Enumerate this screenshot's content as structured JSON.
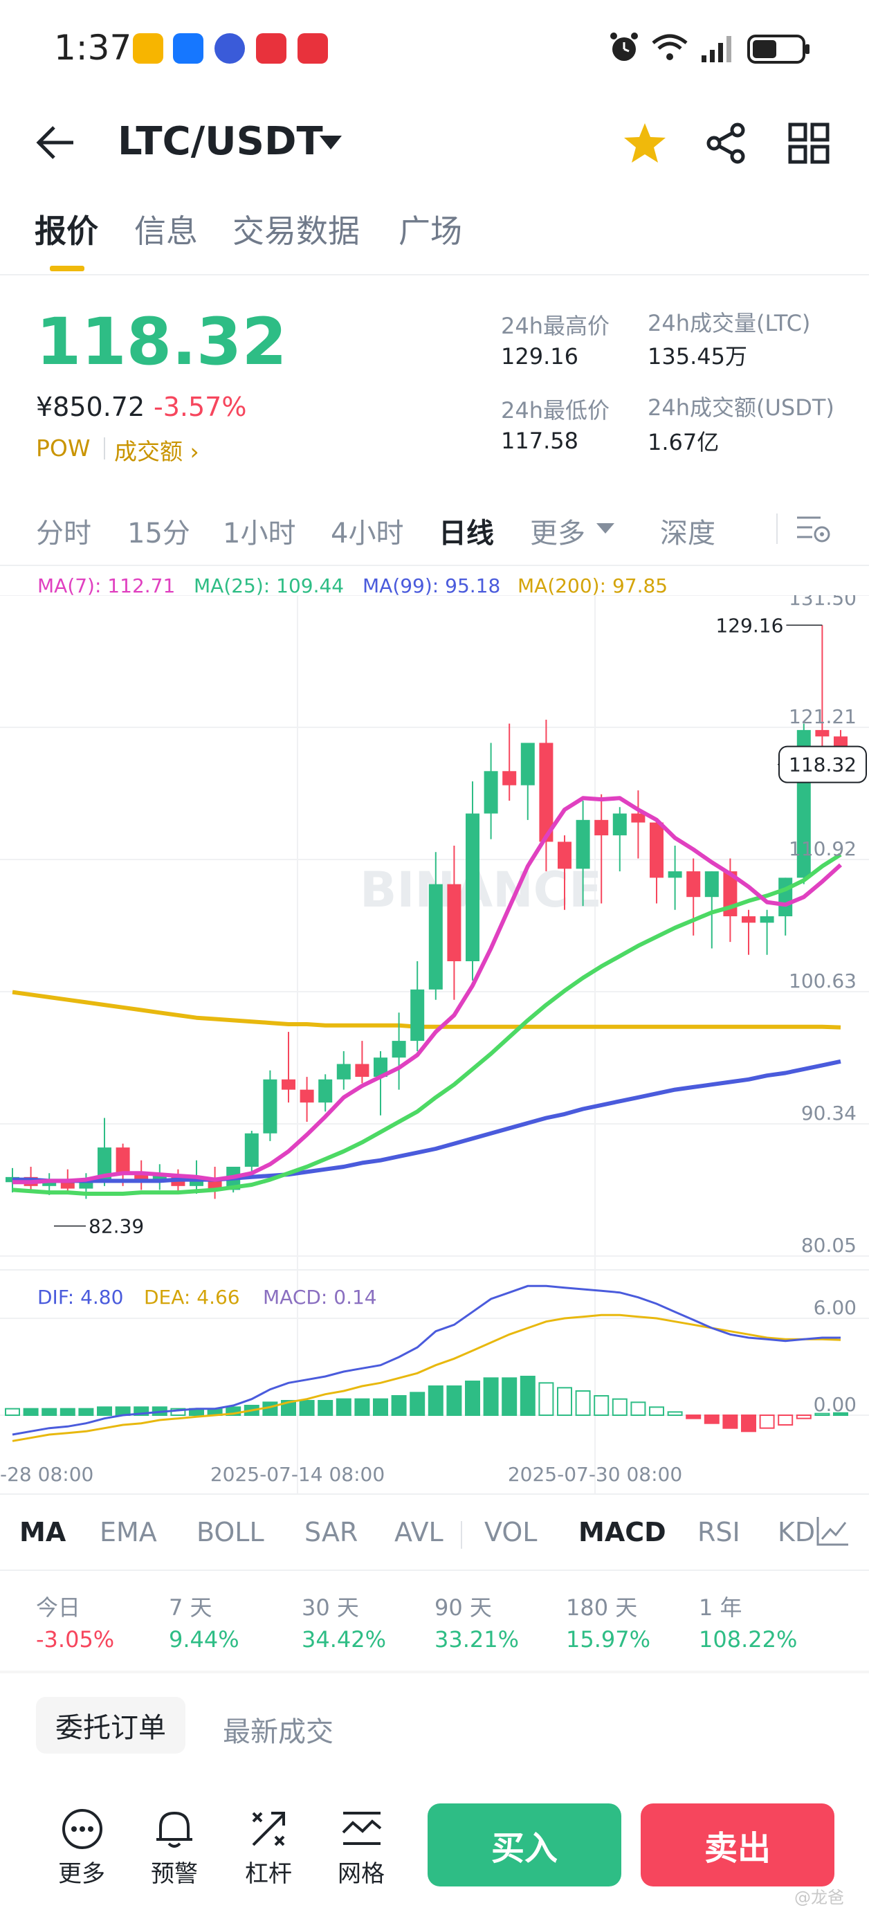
{
  "status_bar": {
    "time": "1:37"
  },
  "header": {
    "pair": "LTC/USDT"
  },
  "tabs": [
    "报价",
    "信息",
    "交易数据",
    "广场"
  ],
  "price": {
    "last": "118.32",
    "cny": "¥850.72",
    "change": "-3.57%",
    "pow": "POW",
    "volume_link": "成交额",
    "high_label": "24h最高价",
    "high": "129.16",
    "low_label": "24h最低价",
    "low": "117.58",
    "vol_ltc_label": "24h成交量(LTC)",
    "vol_ltc": "135.45万",
    "vol_usdt_label": "24h成交额(USDT)",
    "vol_usdt": "1.67亿"
  },
  "intervals": [
    "分时",
    "15分",
    "1小时",
    "4小时",
    "日线",
    "更多",
    "深度"
  ],
  "ma_legend": [
    "MA(7): 112.71",
    "MA(25): 109.44",
    "MA(99): 95.18",
    "MA(200): 97.85"
  ],
  "macd_legend": [
    "DIF: 4.80",
    "DEA: 4.66",
    "MACD: 0.14"
  ],
  "colors": {
    "up": "#2ebd85",
    "down": "#f6465d",
    "ma7": "#e040c0",
    "ma25": "#4cd964",
    "ma99": "#4a5bdc",
    "ma200": "#e8b80e",
    "dif": "#4a5bdc",
    "dea": "#e8b80e"
  },
  "chart_data": {
    "type": "candlestick",
    "price_axis_ticks": [
      "131.50",
      "121.21",
      "110.92",
      "100.63",
      "90.34",
      "80.05"
    ],
    "macd_axis_ticks": [
      "6.00",
      "0.00"
    ],
    "date_ticks": [
      "-28 08:00",
      "2025-07-14 08:00",
      "2025-07-30 08:00"
    ],
    "current_price_tag": "118.32",
    "high_annotation": "129.16",
    "low_annotation": "82.39",
    "watermark": "BINANCE",
    "candles": [
      [
        85.8,
        86.9,
        85.0,
        86.2
      ],
      [
        86.2,
        87.0,
        85.2,
        85.5
      ],
      [
        85.5,
        86.5,
        84.8,
        86.0
      ],
      [
        86.0,
        86.8,
        85.0,
        85.3
      ],
      [
        85.3,
        86.5,
        84.5,
        86.0
      ],
      [
        86.0,
        90.8,
        85.5,
        88.5
      ],
      [
        88.5,
        88.8,
        85.5,
        86.5
      ],
      [
        86.5,
        87.5,
        85.2,
        85.8
      ],
      [
        85.8,
        87.2,
        85.2,
        86.3
      ],
      [
        86.3,
        86.8,
        85.0,
        85.5
      ],
      [
        85.5,
        87.5,
        84.9,
        86.0
      ],
      [
        86.0,
        87.0,
        84.5,
        85.2
      ],
      [
        85.2,
        87.0,
        85.0,
        87.0
      ],
      [
        87.0,
        89.8,
        86.5,
        89.6
      ],
      [
        89.6,
        94.5,
        89.0,
        93.8
      ],
      [
        93.8,
        97.5,
        92.0,
        93.0
      ],
      [
        93.0,
        94.0,
        90.5,
        92.0
      ],
      [
        92.0,
        94.2,
        91.3,
        93.8
      ],
      [
        93.8,
        96.0,
        93.0,
        95.0
      ],
      [
        95.0,
        96.8,
        93.5,
        94.0
      ],
      [
        94.0,
        96.0,
        91.0,
        95.5
      ],
      [
        95.5,
        99.0,
        93.0,
        96.8
      ],
      [
        96.8,
        103.0,
        96.0,
        100.8
      ],
      [
        100.8,
        111.5,
        100.0,
        109.0
      ],
      [
        109.0,
        112.0,
        100.0,
        103.0
      ],
      [
        103.0,
        117.0,
        101.5,
        114.5
      ],
      [
        114.5,
        120.0,
        112.5,
        117.8
      ],
      [
        117.8,
        121.5,
        115.5,
        116.7
      ],
      [
        116.7,
        120.0,
        114.0,
        120.0
      ],
      [
        120.0,
        121.8,
        110.0,
        112.3
      ],
      [
        112.3,
        112.8,
        107.0,
        110.2
      ],
      [
        110.2,
        115.5,
        107.3,
        114.0
      ],
      [
        114.0,
        116.0,
        107.5,
        112.8
      ],
      [
        112.8,
        115.0,
        110.0,
        114.5
      ],
      [
        114.5,
        116.3,
        111.0,
        113.8
      ],
      [
        113.8,
        114.0,
        107.5,
        109.5
      ],
      [
        109.5,
        112.0,
        107.0,
        110.0
      ],
      [
        110.0,
        111.0,
        105.0,
        108.0
      ],
      [
        108.0,
        110.0,
        104.0,
        110.0
      ],
      [
        110.0,
        111.0,
        104.5,
        106.5
      ],
      [
        106.5,
        107.0,
        103.5,
        106.0
      ],
      [
        106.0,
        107.0,
        103.5,
        106.5
      ],
      [
        106.5,
        109.5,
        105.0,
        109.5
      ],
      [
        109.5,
        121.5,
        109.0,
        121.0
      ],
      [
        121.0,
        129.16,
        119.5,
        120.5
      ],
      [
        120.5,
        121.0,
        117.58,
        118.32
      ]
    ],
    "ma7": [
      85.8,
      85.8,
      85.9,
      85.9,
      86.0,
      86.3,
      86.5,
      86.5,
      86.4,
      86.3,
      86.2,
      86.0,
      86.2,
      86.5,
      87.2,
      88.2,
      89.5,
      90.9,
      92.4,
      93.3,
      94.0,
      94.7,
      95.7,
      97.5,
      98.8,
      101.1,
      104.0,
      107.2,
      110.4,
      112.7,
      114.8,
      115.7,
      115.6,
      115.7,
      114.8,
      114.0,
      112.6,
      111.7,
      110.7,
      109.8,
      108.8,
      107.6,
      107.4,
      108.0,
      109.2,
      110.5
    ],
    "ma25": [
      85.2,
      85.1,
      85.0,
      85.0,
      84.9,
      84.9,
      84.9,
      85.0,
      85.0,
      85.0,
      85.1,
      85.2,
      85.4,
      85.6,
      86.0,
      86.5,
      87.0,
      87.6,
      88.2,
      88.9,
      89.7,
      90.5,
      91.3,
      92.4,
      93.4,
      94.6,
      95.8,
      97.1,
      98.4,
      99.6,
      100.7,
      101.7,
      102.6,
      103.4,
      104.2,
      104.9,
      105.6,
      106.2,
      106.8,
      107.2,
      107.7,
      108.1,
      108.6,
      109.3,
      110.4,
      111.3
    ],
    "ma99": [
      86.0,
      86.0,
      85.9,
      85.9,
      85.9,
      85.9,
      85.9,
      85.9,
      85.9,
      86.0,
      86.0,
      86.0,
      86.1,
      86.2,
      86.3,
      86.4,
      86.6,
      86.8,
      87.0,
      87.3,
      87.5,
      87.8,
      88.1,
      88.4,
      88.8,
      89.2,
      89.6,
      90.0,
      90.4,
      90.8,
      91.1,
      91.5,
      91.8,
      92.1,
      92.4,
      92.7,
      93.0,
      93.2,
      93.4,
      93.6,
      93.8,
      94.1,
      94.3,
      94.6,
      94.9,
      95.2
    ],
    "ma200": [
      100.6,
      100.4,
      100.2,
      100.0,
      99.8,
      99.6,
      99.4,
      99.2,
      99.0,
      98.8,
      98.6,
      98.5,
      98.4,
      98.3,
      98.2,
      98.1,
      98.1,
      98.0,
      98.0,
      98.0,
      98.0,
      98.0,
      97.9,
      97.9,
      97.9,
      97.9,
      97.9,
      97.9,
      97.9,
      97.9,
      97.9,
      97.9,
      97.9,
      97.9,
      97.9,
      97.9,
      97.9,
      97.9,
      97.9,
      97.9,
      97.9,
      97.9,
      97.9,
      97.9,
      97.9,
      97.85
    ],
    "macd_hist": [
      0.4,
      0.4,
      0.4,
      0.4,
      0.4,
      0.5,
      0.5,
      0.5,
      0.5,
      0.4,
      0.4,
      0.4,
      0.5,
      0.6,
      0.8,
      0.9,
      0.9,
      0.9,
      1.0,
      1.0,
      1.0,
      1.2,
      1.4,
      1.8,
      1.8,
      2.1,
      2.3,
      2.3,
      2.4,
      2.0,
      1.7,
      1.5,
      1.2,
      1.0,
      0.8,
      0.5,
      0.2,
      -0.2,
      -0.5,
      -0.8,
      -1.0,
      -0.8,
      -0.6,
      -0.2,
      0.1,
      0.14
    ],
    "dif": [
      -1.2,
      -1.0,
      -0.8,
      -0.7,
      -0.5,
      -0.2,
      0.0,
      0.1,
      0.2,
      0.3,
      0.4,
      0.4,
      0.6,
      1.0,
      1.6,
      2.0,
      2.2,
      2.4,
      2.7,
      2.9,
      3.1,
      3.6,
      4.2,
      5.2,
      5.6,
      6.4,
      7.2,
      7.6,
      8.0,
      8.0,
      7.9,
      7.8,
      7.7,
      7.6,
      7.3,
      6.9,
      6.4,
      5.9,
      5.4,
      5.0,
      4.8,
      4.7,
      4.6,
      4.7,
      4.8,
      4.8
    ],
    "dea": [
      -1.6,
      -1.4,
      -1.2,
      -1.1,
      -1.0,
      -0.8,
      -0.6,
      -0.5,
      -0.3,
      -0.2,
      -0.1,
      0.0,
      0.1,
      0.3,
      0.5,
      0.8,
      1.0,
      1.3,
      1.5,
      1.8,
      2.0,
      2.3,
      2.6,
      3.1,
      3.5,
      4.0,
      4.5,
      5.0,
      5.4,
      5.8,
      6.0,
      6.1,
      6.2,
      6.2,
      6.1,
      6.0,
      5.8,
      5.6,
      5.4,
      5.2,
      5.0,
      4.8,
      4.7,
      4.7,
      4.7,
      4.66
    ]
  },
  "indicators": [
    "MA",
    "EMA",
    "BOLL",
    "SAR",
    "AVL",
    "VOL",
    "MACD",
    "RSI",
    "KD"
  ],
  "periods": [
    {
      "label": "今日",
      "value": "-3.05%",
      "neg": true
    },
    {
      "label": "7 天",
      "value": "9.44%",
      "neg": false
    },
    {
      "label": "30 天",
      "value": "34.42%",
      "neg": false
    },
    {
      "label": "90 天",
      "value": "33.21%",
      "neg": false
    },
    {
      "label": "180 天",
      "value": "15.97%",
      "neg": false
    },
    {
      "label": "1 年",
      "value": "108.22%",
      "neg": false
    }
  ],
  "orders": {
    "tab_active": "委托订单",
    "tab_other": "最新成交"
  },
  "bottom": {
    "more": "更多",
    "alert": "预警",
    "leverage": "杠杆",
    "grid": "网格",
    "buy": "买入",
    "sell": "卖出"
  },
  "watermark_corner": "@龙爸"
}
